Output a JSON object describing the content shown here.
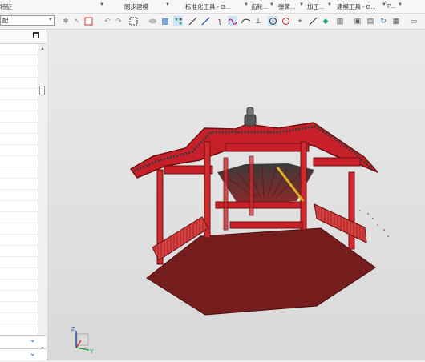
{
  "ribbon": {
    "groups": [
      {
        "label": "特征"
      },
      {
        "label": "同步建模"
      },
      {
        "label": "标准化工具 - G..."
      },
      {
        "label": "齿轮..."
      },
      {
        "label": "弹簧..."
      },
      {
        "label": "加工..."
      },
      {
        "label": "建模工具 - G..."
      },
      {
        "label": "P..."
      }
    ]
  },
  "toolbar": {
    "filter_value": "配",
    "icons": [
      "snap-icon",
      "select-icon",
      "undo-icon",
      "redo-icon",
      "box-select-icon",
      "view-icon",
      "shade-icon",
      "grid-icon",
      "line-icon",
      "pen-icon",
      "curve-icon",
      "wave-icon",
      "spline-icon",
      "tangent-icon",
      "circle-point-icon",
      "circle-icon",
      "plus-icon",
      "edit-line-icon",
      "measure-icon",
      "layer-icon",
      "render-icon",
      "view-settings-icon",
      "refresh-icon",
      "display-icon"
    ]
  },
  "left_panel": {
    "row_count": 25
  },
  "viewport": {
    "colors": {
      "roof": "#c8202a",
      "dark_red": "#6e1010",
      "floor": "#7a1f1f",
      "finial": "#555555"
    },
    "axis_labels": {
      "z": "Z",
      "y": "Y"
    }
  }
}
